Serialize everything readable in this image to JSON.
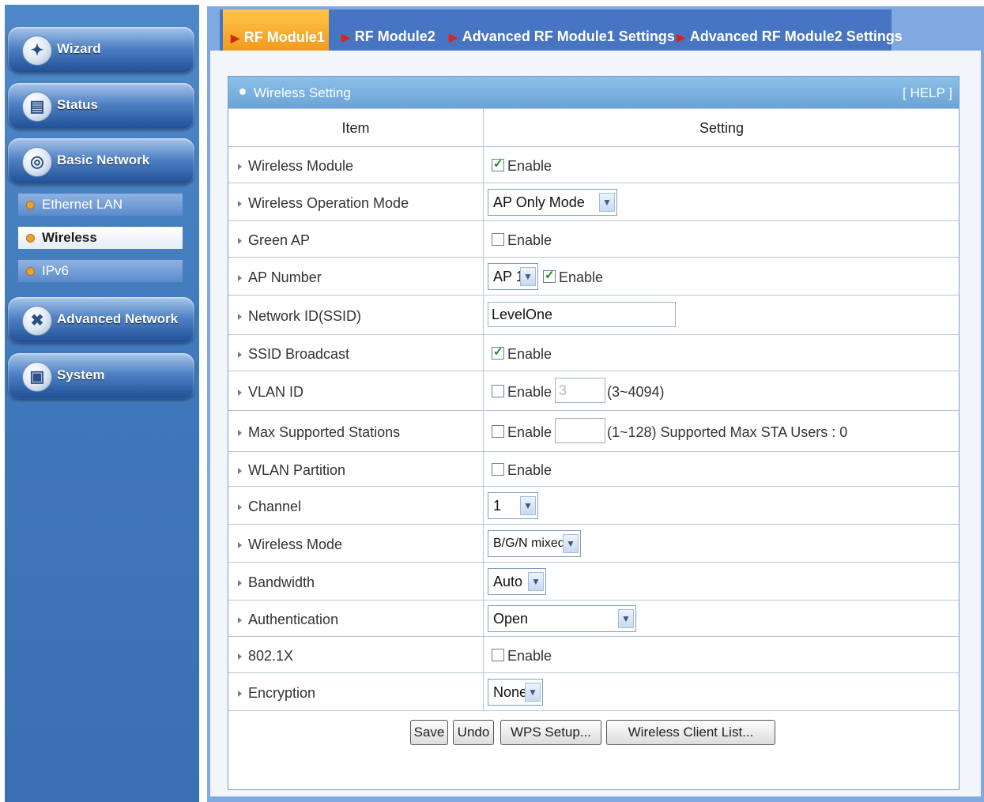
{
  "sidebar": {
    "items": [
      {
        "label": "Wizard",
        "icon": "wizard-wand-icon"
      },
      {
        "label": "Status",
        "icon": "status-chart-icon"
      },
      {
        "label": "Basic Network",
        "icon": "globe-icon"
      },
      {
        "label": "Advanced Network",
        "icon": "tools-icon"
      },
      {
        "label": "System",
        "icon": "computer-icon"
      }
    ],
    "subitems": [
      {
        "label": "Ethernet LAN"
      },
      {
        "label": "Wireless"
      },
      {
        "label": "IPv6"
      }
    ]
  },
  "tabs": [
    {
      "label": "RF Module1"
    },
    {
      "label": "RF Module2"
    },
    {
      "label": "Advanced RF Module1 Settings"
    },
    {
      "label": "Advanced RF Module2 Settings"
    }
  ],
  "panel": {
    "title": "Wireless Setting",
    "help": "[ HELP ]",
    "col_item": "Item",
    "col_setting": "Setting"
  },
  "rows": {
    "wireless_module": {
      "label": "Wireless Module",
      "enable": "Enable"
    },
    "operation_mode": {
      "label": "Wireless Operation Mode",
      "value": "AP Only Mode"
    },
    "green_ap": {
      "label": "Green AP",
      "enable": "Enable"
    },
    "ap_number": {
      "label": "AP Number",
      "value": "AP 1",
      "enable": "Enable"
    },
    "ssid": {
      "label": "Network ID(SSID)",
      "value": "LevelOne"
    },
    "ssid_broadcast": {
      "label": "SSID Broadcast",
      "enable": "Enable"
    },
    "vlan_id": {
      "label": "VLAN ID",
      "enable": "Enable",
      "value": "3",
      "hint": "(3~4094)"
    },
    "max_stations": {
      "label": "Max Supported Stations",
      "enable": "Enable",
      "value": "",
      "hint": "(1~128) Supported Max STA Users : 0"
    },
    "wlan_partition": {
      "label": "WLAN Partition",
      "enable": "Enable"
    },
    "channel": {
      "label": "Channel",
      "value": "1"
    },
    "wireless_mode": {
      "label": "Wireless Mode",
      "value": "B/G/N mixed"
    },
    "bandwidth": {
      "label": "Bandwidth",
      "value": "Auto"
    },
    "authentication": {
      "label": "Authentication",
      "value": "Open"
    },
    "dot1x": {
      "label": "802.1X",
      "enable": "Enable"
    },
    "encryption": {
      "label": "Encryption",
      "value": "None"
    }
  },
  "buttons": {
    "save": "Save",
    "undo": "Undo",
    "wps": "WPS Setup...",
    "client_list": "Wireless Client List..."
  },
  "colors": {
    "tab_active": "#f29b1c",
    "tab_bar": "#4775c4",
    "panel_header": "#6aa3d8",
    "sidebar": "#3f78ba"
  }
}
